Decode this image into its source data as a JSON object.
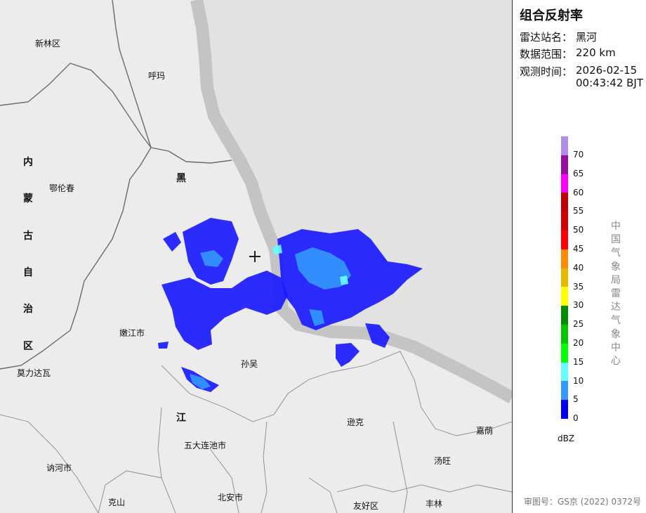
{
  "panel": {
    "title": "组合反射率",
    "station_label": "雷达站名：",
    "station_value": "黑河",
    "range_label": "数据范围：",
    "range_value": "220 km",
    "time_label": "观测时间：",
    "time_date": "2026-02-15",
    "time_clock": "00:43:42 BJT",
    "unit": "dBZ",
    "vertical_label": [
      "中",
      "国",
      "气",
      "象",
      "局",
      "雷",
      "达",
      "气",
      "象",
      "中",
      "心"
    ],
    "approval": "审图号：GS京 (2022) 0372号"
  },
  "legend": {
    "ticks": [
      "70",
      "65",
      "60",
      "55",
      "50",
      "45",
      "40",
      "35",
      "30",
      "25",
      "20",
      "15",
      "10",
      "5",
      "0"
    ],
    "colors": [
      "#b08ee6",
      "#9a0fa0",
      "#ff00ff",
      "#c00000",
      "#d40000",
      "#ff0000",
      "#ff8c00",
      "#e6b800",
      "#ffff00",
      "#008c00",
      "#00c800",
      "#00ff00",
      "#66ffff",
      "#3399ff",
      "#0000f6"
    ]
  },
  "map": {
    "places": [
      {
        "name": "新林区"
      },
      {
        "name": "呼玛"
      },
      {
        "name": "鄂伦春"
      },
      {
        "name": "嫩江市"
      },
      {
        "name": "孙吴"
      },
      {
        "name": "莫力达瓦"
      },
      {
        "name": "逊克"
      },
      {
        "name": "五大连池市"
      },
      {
        "name": "嘉荫"
      },
      {
        "name": "讷河市"
      },
      {
        "name": "汤旺"
      },
      {
        "name": "克山"
      },
      {
        "name": "北安市"
      },
      {
        "name": "友好区"
      },
      {
        "name": "丰林"
      }
    ],
    "regions": [
      {
        "name": "内"
      },
      {
        "name": "蒙"
      },
      {
        "name": "古"
      },
      {
        "name": "自"
      },
      {
        "name": "治"
      },
      {
        "name": "区"
      },
      {
        "name": "黑"
      },
      {
        "name": "江"
      }
    ],
    "colors": {
      "land": "#ececec",
      "russia": "#e2e2e2",
      "river": "#c4c4c4",
      "border": "#6a6a6a"
    }
  }
}
